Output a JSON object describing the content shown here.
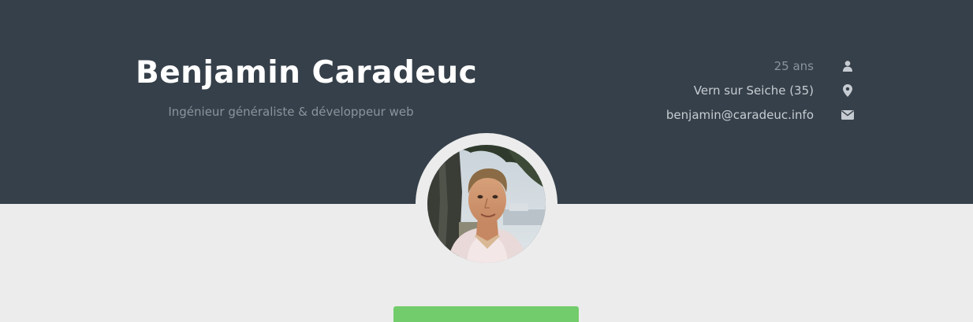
{
  "profile": {
    "name": "Benjamin Caradeuc",
    "title": "Ingénieur généraliste & développeur web"
  },
  "info": {
    "age": "25 ans",
    "location": "Vern sur Seiche (35)",
    "email": "benjamin@caradeuc.info"
  },
  "icons": {
    "age": "user-icon",
    "location": "map-marker-icon",
    "email": "envelope-icon"
  },
  "colors": {
    "header_bg": "#36404a",
    "page_bg": "#ececec",
    "accent_green": "#73cc6c",
    "text_light": "#c6ccd2",
    "text_muted": "#8a949d"
  }
}
